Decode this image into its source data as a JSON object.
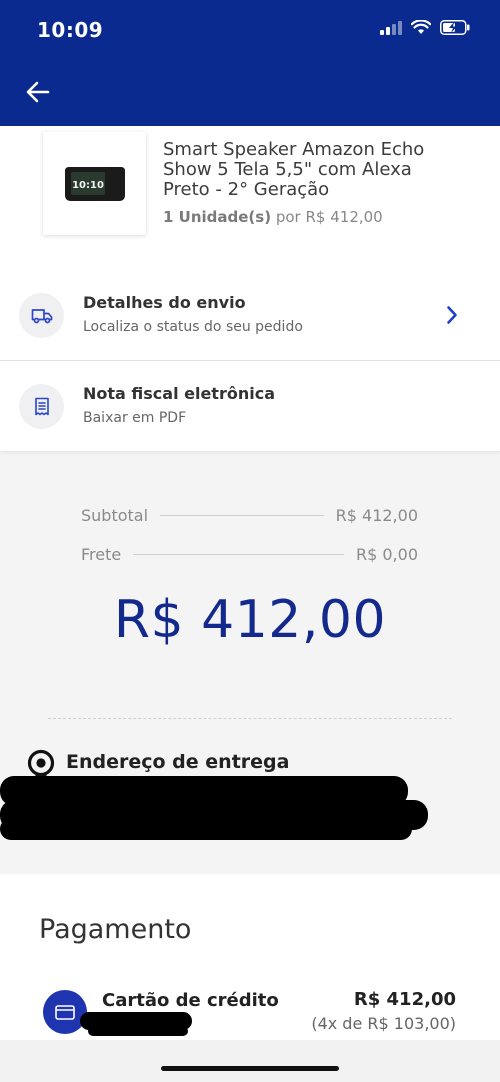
{
  "status_bar": {
    "time": "10:09"
  },
  "header": {
    "back_icon": "arrow-left-icon"
  },
  "product": {
    "title": "Smart Speaker Amazon Echo Show 5 Tela 5,5\" com Alexa Preto - 2° Geração",
    "quantity": "1 Unidade(s)",
    "unit_price": "por R$ 412,00",
    "thumb_screen_text": "10:10"
  },
  "shipping": {
    "title": "Detalhes do envio",
    "subtitle": "Localiza o status do seu pedido",
    "icon": "truck-icon"
  },
  "invoice": {
    "title": "Nota fiscal eletrônica",
    "subtitle": "Baixar em PDF",
    "icon": "receipt-icon"
  },
  "summary": {
    "subtotal_label": "Subtotal",
    "subtotal_value": "R$ 412,00",
    "shipping_label": "Frete",
    "shipping_value": "R$ 0,00",
    "total": "R$ 412,00"
  },
  "address": {
    "label": "Endereço de entrega",
    "icon": "location-pin-icon"
  },
  "payment": {
    "title": "Pagamento",
    "method": "Cartão de crédito",
    "amount": "R$ 412,00",
    "installments": "(4x de R$ 103,00)",
    "icon": "credit-card-icon"
  },
  "colors": {
    "brand_blue": "#0b2a8f",
    "total_blue": "#14298c",
    "card_icon_blue": "#1f35b0"
  }
}
